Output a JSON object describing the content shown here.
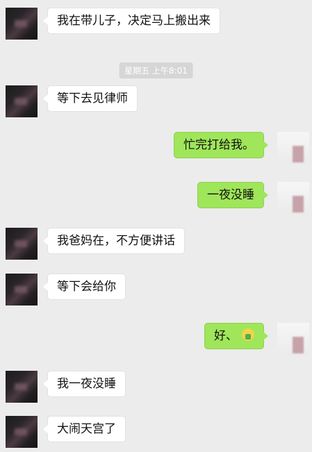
{
  "timestamp": "星期五 上午8:01",
  "messages": [
    {
      "side": "left",
      "text": "我在带儿子，决定马上搬出来"
    },
    {
      "side": "left",
      "text": "等下去见律师"
    },
    {
      "side": "right",
      "text": "忙完打给我。"
    },
    {
      "side": "right",
      "text": "一夜没睡"
    },
    {
      "side": "left",
      "text": "我爸妈在，不方便讲话"
    },
    {
      "side": "left",
      "text": "等下会给你"
    },
    {
      "side": "right",
      "text": "好、"
    },
    {
      "side": "left",
      "text": "我一夜没睡"
    },
    {
      "side": "left",
      "text": "大闹天宫了"
    }
  ]
}
